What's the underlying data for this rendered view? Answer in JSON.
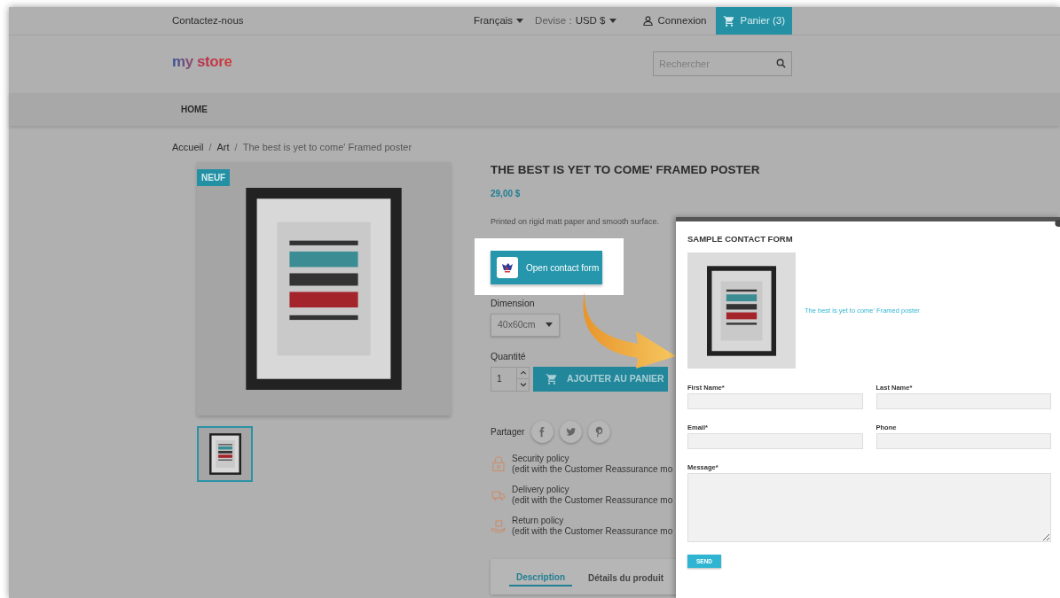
{
  "top_bar": {
    "contact": "Contactez-nous",
    "language": "Français",
    "currency_label": "Devise :",
    "currency": "USD $",
    "login": "Connexion",
    "cart": "Panier (3)"
  },
  "logo": "my store",
  "search": {
    "placeholder": "Rechercher"
  },
  "nav": [
    {
      "label": "HOME"
    }
  ],
  "breadcrumb_separator": "/",
  "breadcrumb": [
    "Accueil",
    "Art",
    "The best is yet to come' Framed poster"
  ],
  "product": {
    "badge": "NEUF",
    "thumbnails": [
      {
        "selected": true
      }
    ],
    "title": "THE BEST IS YET TO COME' FRAMED POSTER",
    "price": "29,00 $",
    "summary": "Printed on rigid matt paper and smooth surface.",
    "contact_button": "Open contact form",
    "dimension": {
      "label": "Dimension",
      "value": "40x60cm"
    },
    "quantity": {
      "label": "Quantité",
      "value": "1"
    },
    "add_to_cart": "AJOUTER AU PANIER",
    "share_label": "Partager",
    "share": [
      {
        "kind": "facebook"
      },
      {
        "kind": "twitter"
      },
      {
        "kind": "pinterest"
      }
    ],
    "reassurance": [
      {
        "kind": "security",
        "title": "Security policy",
        "text": "(edit with the Customer Reassurance mo"
      },
      {
        "kind": "delivery",
        "title": "Delivery policy",
        "text": "(edit with the Customer Reassurance mo"
      },
      {
        "kind": "return",
        "title": "Return policy",
        "text": "(edit with the Customer Reassurance mo"
      }
    ],
    "tabs": [
      {
        "label": "Description",
        "selected": true
      },
      {
        "label": "Détails du produit",
        "selected": false
      }
    ]
  },
  "modal": {
    "title": "SAMPLE CONTACT FORM",
    "product_link": "The best is yet to come' Framed poster",
    "fields": [
      {
        "label": "First Name*",
        "kind": "input"
      },
      {
        "label": "Last Name*",
        "kind": "input"
      },
      {
        "label": "Email*",
        "kind": "input"
      },
      {
        "label": "Phone",
        "kind": "input"
      },
      {
        "label": "Message*",
        "kind": "textarea"
      }
    ],
    "submit": "SEND"
  }
}
